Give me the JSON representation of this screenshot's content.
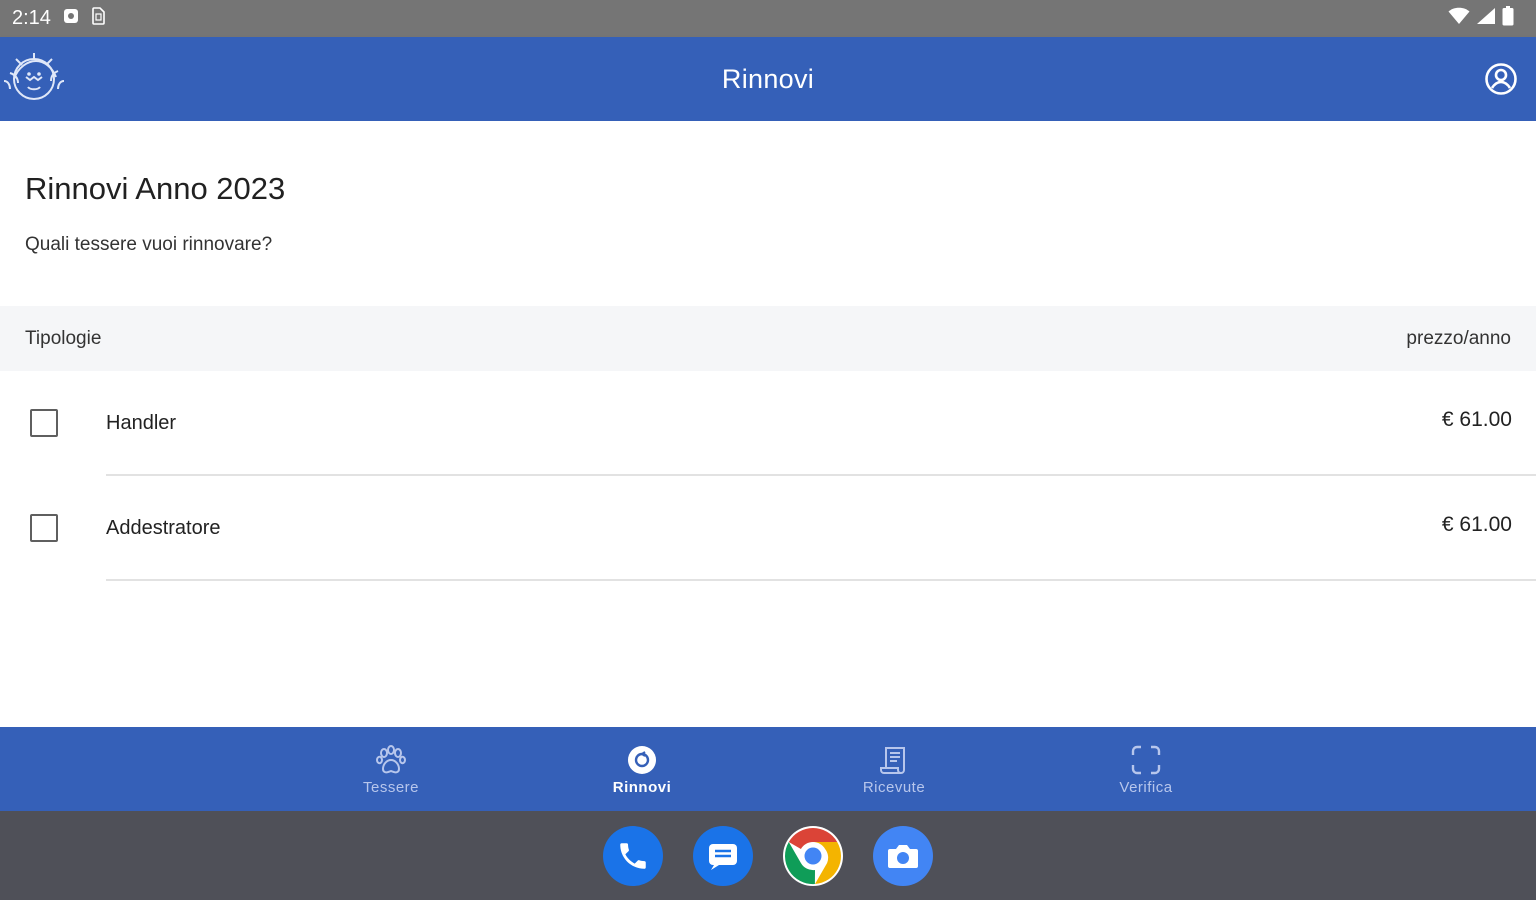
{
  "status_bar": {
    "time": "2:14"
  },
  "app_bar": {
    "title": "Rinnovi"
  },
  "page": {
    "title": "Rinnovi Anno 2023",
    "subtitle": "Quali tessere vuoi rinnovare?"
  },
  "table": {
    "header_left": "Tipologie",
    "header_right": "prezzo/anno",
    "rows": [
      {
        "label": "Handler",
        "price": "€ 61.00",
        "checked": false
      },
      {
        "label": "Addestratore",
        "price": "€ 61.00",
        "checked": false
      }
    ]
  },
  "bottom_nav": {
    "items": [
      {
        "label": "Tessere",
        "icon": "paw-icon",
        "active": false
      },
      {
        "label": "Rinnovi",
        "icon": "renew-icon",
        "active": true
      },
      {
        "label": "Ricevute",
        "icon": "receipt-icon",
        "active": false
      },
      {
        "label": "Verifica",
        "icon": "scan-icon",
        "active": false
      }
    ]
  },
  "dock": {
    "apps": [
      "phone-icon",
      "messages-icon",
      "chrome-icon",
      "camera-icon"
    ]
  },
  "colors": {
    "primary": "#3560b8",
    "status_bar": "#757575",
    "dock": "#4f5058",
    "header_bg": "#f5f6f8"
  }
}
